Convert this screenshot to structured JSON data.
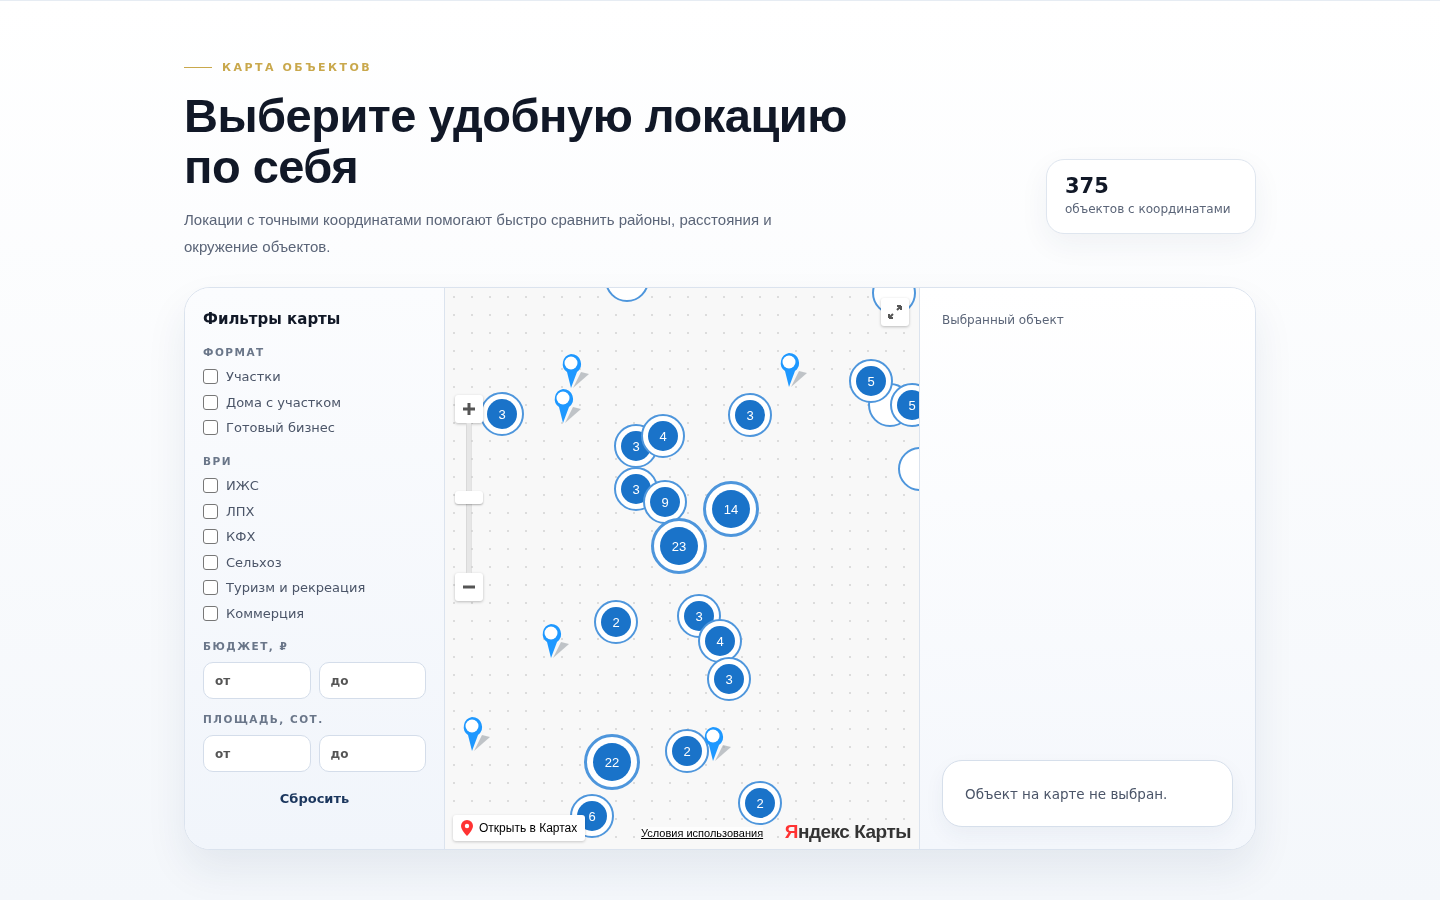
{
  "header": {
    "eyebrow": "КАРТА ОБЪЕКТОВ",
    "title": "Выберите удобную локацию по себя",
    "subtitle": "Локации с точными координатами помогают быстро сравнить районы, расстояния и окружение объектов.",
    "stat": {
      "value": "375",
      "label": "объектов с координатами"
    }
  },
  "filters": {
    "title": "Фильтры карты",
    "groups": [
      {
        "title": "ФОРМАТ",
        "options": [
          {
            "label": "Участки",
            "checked": false
          },
          {
            "label": "Дома с участком",
            "checked": false
          },
          {
            "label": "Готовый бизнес",
            "checked": false
          }
        ]
      },
      {
        "title": "ВРИ",
        "options": [
          {
            "label": "ИЖС",
            "checked": false
          },
          {
            "label": "ЛПХ",
            "checked": false
          },
          {
            "label": "КФХ",
            "checked": false
          },
          {
            "label": "Сельхоз",
            "checked": false
          },
          {
            "label": "Туризм и рекреация",
            "checked": false
          },
          {
            "label": "Коммерция",
            "checked": false
          }
        ]
      }
    ],
    "ranges": [
      {
        "title": "БЮДЖЕТ, ₽",
        "from_placeholder": "от",
        "to_placeholder": "до"
      },
      {
        "title": "ПЛОЩАДЬ, СОТ.",
        "from_placeholder": "от",
        "to_placeholder": "до"
      }
    ],
    "reset": "Сбросить"
  },
  "map": {
    "clusters": [
      {
        "count": "3"
      },
      {
        "count": "3"
      },
      {
        "count": "3"
      },
      {
        "count": "4"
      },
      {
        "count": "3"
      },
      {
        "count": "9"
      },
      {
        "count": "14"
      },
      {
        "count": "23"
      },
      {
        "count": "2"
      },
      {
        "count": "3"
      },
      {
        "count": "4"
      },
      {
        "count": "3"
      },
      {
        "count": "2"
      },
      {
        "count": "22"
      },
      {
        "count": "6"
      },
      {
        "count": "2"
      },
      {
        "count": "5"
      },
      {
        "count": "5"
      }
    ],
    "open_in_maps": "Открыть в Картах",
    "terms": "Условия использования",
    "logo": "Яндекс Карты"
  },
  "selected": {
    "title": "Выбранный объект",
    "empty": "Объект на карте не выбран."
  }
}
